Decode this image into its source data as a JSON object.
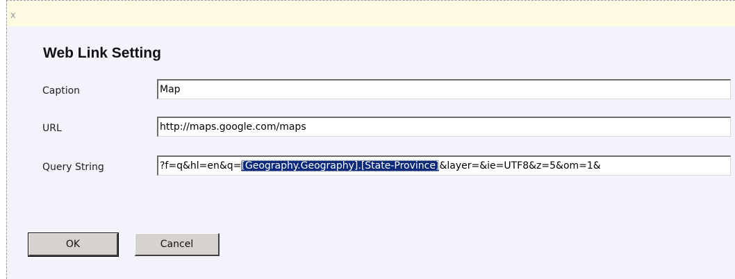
{
  "dialog": {
    "close_label": "x",
    "title": "Web Link Setting"
  },
  "fields": {
    "caption": {
      "label": "Caption",
      "value": "Map"
    },
    "url": {
      "label": "URL",
      "value": "http://maps.google.com/maps"
    },
    "query_string": {
      "label": "Query String",
      "value_prefix": "?f=q&hl=en&q=",
      "value_selected": "[Geography.Geography].[State-Province]",
      "value_suffix": "&layer=&ie=UTF8&z=5&om=1&"
    }
  },
  "buttons": {
    "ok_label": "OK",
    "cancel_label": "Cancel"
  }
}
